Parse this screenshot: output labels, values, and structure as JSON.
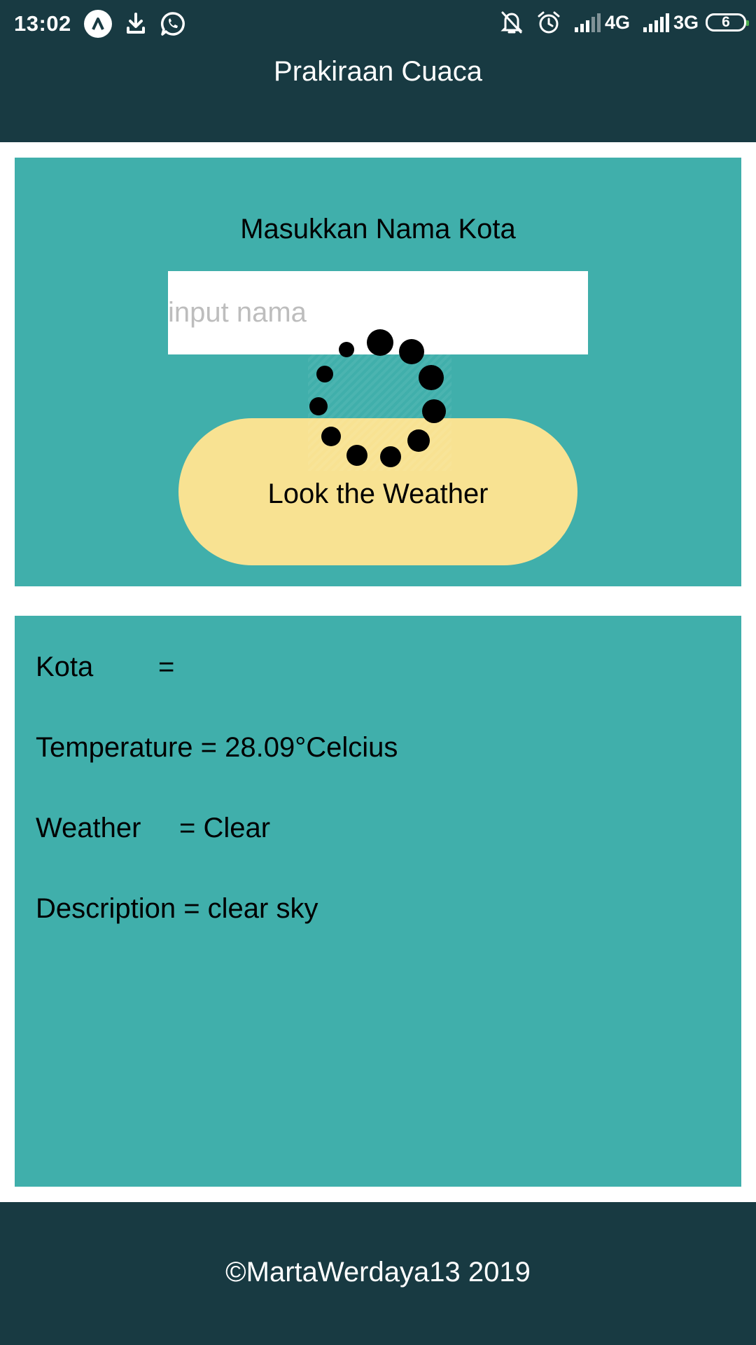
{
  "status_bar": {
    "time": "13:02",
    "network_1": "4G",
    "network_2": "3G",
    "battery": "6",
    "icons_left": [
      "app-launcher-icon",
      "download-icon",
      "whatsapp-icon"
    ],
    "icons_right": [
      "notifications-off-icon",
      "alarm-icon",
      "signal-icon",
      "signal-icon"
    ]
  },
  "app": {
    "title": "Prakiraan Cuaca"
  },
  "search": {
    "heading": "Masukkan Nama Kota",
    "placeholder": "input nama",
    "value": "",
    "button_label": "Look the Weather"
  },
  "result": {
    "kota_label": "Kota",
    "kota_sep": "=",
    "kota_value": "",
    "temperature_text": "Temperature = 28.09°Celcius",
    "weather_label": "Weather",
    "weather_value": "= Clear",
    "description_text": "Description = clear sky"
  },
  "loading_indicator": "loading-spinner-icon",
  "footer": {
    "text": "©MartaWerdaya13 2019"
  },
  "colors": {
    "appbar": "#183a42",
    "card": "#40afab",
    "button": "#f8e292",
    "background": "#ffffff"
  }
}
